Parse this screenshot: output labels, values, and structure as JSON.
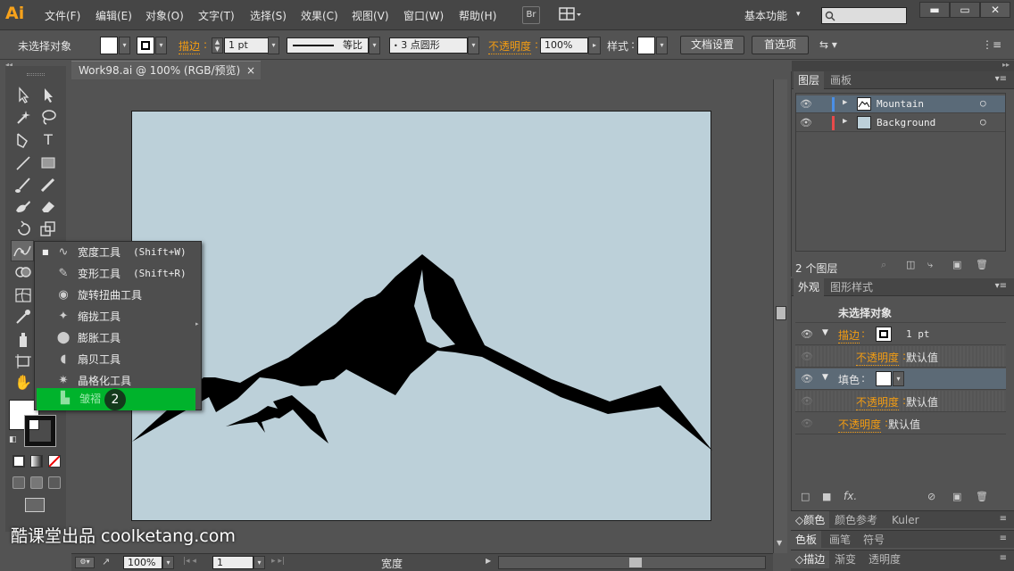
{
  "app": {
    "logo": "Ai",
    "workspace": "基本功能",
    "workspace_arrow": "▾"
  },
  "menu": [
    "文件(F)",
    "编辑(E)",
    "对象(O)",
    "文字(T)",
    "选择(S)",
    "效果(C)",
    "视图(V)",
    "窗口(W)",
    "帮助(H)"
  ],
  "menubar_buttons": {
    "bridge": "Br"
  },
  "window_controls": {
    "minimize": "▬",
    "maximize": "▭",
    "close": "✕"
  },
  "controlbar": {
    "selection_label": "未选择对象",
    "stroke_label": "描边",
    "stroke_weight": "1 pt",
    "profile_label": "等比",
    "brush_label": "3 点圆形",
    "opacity_label": "不透明度",
    "opacity_value": "100%",
    "style_label": "样式",
    "doc_setup_button": "文档设置",
    "preferences_button": "首选项"
  },
  "document": {
    "tab_title": "Work98.ai @ 100% (RGB/预览)",
    "tab_close": "×"
  },
  "status": {
    "zoom": "100%",
    "artboard_num": "1",
    "tool_name": "宽度"
  },
  "layers_panel": {
    "tabs": [
      "图层",
      "画板"
    ],
    "layers": [
      {
        "name": "Mountain",
        "color": "#4a8fe7"
      },
      {
        "name": "Background",
        "color": "#e74a4a"
      }
    ],
    "count": "2 个图层"
  },
  "appearance_panel": {
    "tabs": [
      "外观",
      "图形样式"
    ],
    "header": "未选择对象",
    "stroke_label": "描边",
    "stroke_weight": "1 pt",
    "opacity_label": "不透明度",
    "default_value": "默认值",
    "fill_label": "填色"
  },
  "collapsed_panels": [
    [
      "颜色",
      "颜色参考",
      "Kuler"
    ],
    [
      "色板",
      "画笔",
      "符号"
    ],
    [
      "描边",
      "渐变",
      "透明度"
    ]
  ],
  "flyout": {
    "items": [
      {
        "label": "宽度工具",
        "shortcut": "(Shift+W)",
        "icon": "width-tool-icon",
        "checked": true
      },
      {
        "label": "变形工具",
        "shortcut": "(Shift+R)",
        "icon": "warp-tool-icon"
      },
      {
        "label": "旋转扭曲工具",
        "shortcut": "",
        "icon": "twirl-tool-icon"
      },
      {
        "label": "缩拢工具",
        "shortcut": "",
        "icon": "pucker-tool-icon"
      },
      {
        "label": "膨胀工具",
        "shortcut": "",
        "icon": "bloat-tool-icon"
      },
      {
        "label": "扇贝工具",
        "shortcut": "",
        "icon": "scallop-tool-icon"
      },
      {
        "label": "晶格化工具",
        "shortcut": "",
        "icon": "crystallize-tool-icon"
      },
      {
        "label": "皱褶",
        "shortcut": "",
        "icon": "wrinkle-tool-icon",
        "highlighted": true
      }
    ],
    "step_badge": "2",
    "highlight_color": "#00b32c"
  },
  "watermark": "酷课堂出品 coolketang.com",
  "colors": {
    "artboard": "#bcd0d9",
    "accent_orange": "#f39c12",
    "highlight": "#00b32c"
  }
}
